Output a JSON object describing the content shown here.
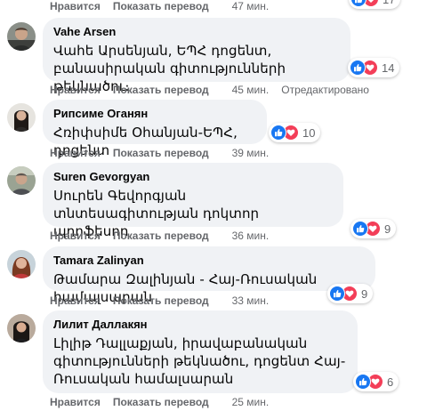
{
  "colors": {
    "like": "#1877f2",
    "love": "#f33e58",
    "bubble": "#f0f2f5",
    "meta": "#65676b"
  },
  "top_row": {
    "like": "Нравится",
    "translate": "Показать перевод",
    "time": "47 мин.",
    "reaction_count": "17"
  },
  "comments": [
    {
      "author": "Vahe Arsen",
      "text": "Վահե Արսենյան, ԵՊՀ դոցենտ, բանասիրական գիտությունների թեկնածու։",
      "reaction_count": "14",
      "like": "Нравится",
      "translate": "Показать перевод",
      "time": "45 мин.",
      "edited": "Отредактировано",
      "avatar": "avatar-man-photo"
    },
    {
      "author": "Рипсиме Оганян",
      "text": "Հռիփսիմե Օհանյան-ԵՊՀ, դոցենտ",
      "reaction_count": "10",
      "like": "Нравится",
      "translate": "Показать перевод",
      "time": "39 мин.",
      "avatar": "avatar-woman-photo"
    },
    {
      "author": "Suren Gevorgyan",
      "text": "Սուրեն Գեվորգյան տնտեսագիտության դոկտոր պրոֆեսոր",
      "reaction_count": "9",
      "like": "Нравится",
      "translate": "Показать перевод",
      "time": "36 мин.",
      "avatar": "avatar-man-photo"
    },
    {
      "author": "Tamara Zalinyan",
      "text": "Թամարա Զալինյան - Հայ-Ռուսական համալսարան",
      "reaction_count": "9",
      "like": "Нравится",
      "translate": "Показать перевод",
      "time": "33 мин.",
      "avatar": "avatar-woman-photo"
    },
    {
      "author": "Лилит Даллакян",
      "text": "Լիլիթ Դալլաքյան, իրավաբանական գիտությունների թեկնածու, դոցենտ Հայ-Ռուսական համալսարան",
      "reaction_count": "6",
      "like": "Нравится",
      "translate": "Показать перевод",
      "time": "25 мин.",
      "avatar": "avatar-woman-photo"
    }
  ]
}
